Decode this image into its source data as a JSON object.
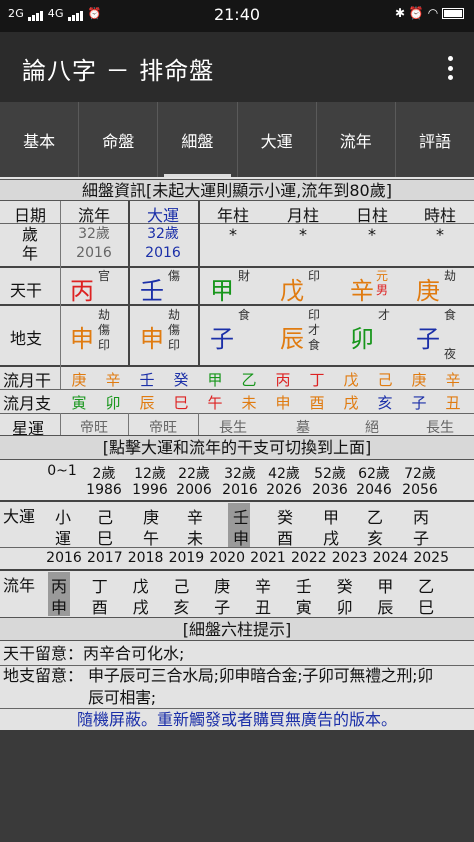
{
  "status": {
    "network1": "2G",
    "network2": "4G",
    "time": "21:40"
  },
  "app": {
    "title": "論八字 － 排命盤"
  },
  "tabs": [
    "基本",
    "命盤",
    "細盤",
    "大運",
    "流年",
    "評語"
  ],
  "section1_title": "細盤資訊[未起大運則顯示小運,流年到80歲]",
  "table": {
    "headers": [
      "日期",
      "流年",
      "大運",
      "年柱",
      "月柱",
      "日柱",
      "時柱"
    ],
    "age_label": "歲年",
    "age_cols": [
      {
        "age": "32歲",
        "year": "2016"
      },
      {
        "age": "32歲",
        "year": "2016"
      }
    ],
    "stars": [
      "*",
      "*",
      "*",
      "*"
    ],
    "tiangan_label": "天干",
    "tiangan": [
      {
        "char": "丙",
        "note": "官",
        "color": "red"
      },
      {
        "char": "壬",
        "note": "傷",
        "color": "blue"
      },
      {
        "char": "甲",
        "note": "財",
        "color": "green"
      },
      {
        "char": "戊",
        "note": "印",
        "color": "orange"
      },
      {
        "char": "辛",
        "note": "元男",
        "color": "orange"
      },
      {
        "char": "庚",
        "note": "劫",
        "color": "orange"
      }
    ],
    "dizhi_label": "地支",
    "dizhi": [
      {
        "char": "申",
        "notes": [
          "劫",
          "傷",
          "印"
        ],
        "color": "orange"
      },
      {
        "char": "申",
        "notes": [
          "劫",
          "傷",
          "印"
        ],
        "color": "orange"
      },
      {
        "char": "子",
        "notes": [
          "食"
        ],
        "color": "blue"
      },
      {
        "char": "辰",
        "notes": [
          "印",
          "才",
          "食"
        ],
        "color": "orange"
      },
      {
        "char": "卯",
        "notes": [
          "才"
        ],
        "color": "green"
      },
      {
        "char": "子",
        "notes": [
          "食",
          "夜"
        ],
        "color": "blue"
      }
    ],
    "liuyuegan_label": "流月干",
    "liuyuegan": [
      {
        "c": "庚",
        "col": "orange"
      },
      {
        "c": "辛",
        "col": "orange"
      },
      {
        "c": "壬",
        "col": "blue"
      },
      {
        "c": "癸",
        "col": "blue"
      },
      {
        "c": "甲",
        "col": "green"
      },
      {
        "c": "乙",
        "col": "green"
      },
      {
        "c": "丙",
        "col": "red"
      },
      {
        "c": "丁",
        "col": "red"
      },
      {
        "c": "戊",
        "col": "orange"
      },
      {
        "c": "己",
        "col": "orange"
      },
      {
        "c": "庚",
        "col": "orange"
      },
      {
        "c": "辛",
        "col": "orange"
      }
    ],
    "liuyuezhi_label": "流月支",
    "liuyuezhi": [
      {
        "c": "寅",
        "col": "green"
      },
      {
        "c": "卯",
        "col": "green"
      },
      {
        "c": "辰",
        "col": "orange"
      },
      {
        "c": "巳",
        "col": "red"
      },
      {
        "c": "午",
        "col": "red"
      },
      {
        "c": "未",
        "col": "orange"
      },
      {
        "c": "申",
        "col": "orange"
      },
      {
        "c": "酉",
        "col": "orange"
      },
      {
        "c": "戌",
        "col": "orange"
      },
      {
        "c": "亥",
        "col": "blue"
      },
      {
        "c": "子",
        "col": "blue"
      },
      {
        "c": "丑",
        "col": "orange"
      }
    ],
    "xingyun_label": "星運",
    "xingyun": [
      "帝旺",
      "帝旺",
      "長生",
      "墓",
      "絕",
      "長生"
    ]
  },
  "section2_title": "[點擊大運和流年的干支可切換到上面]",
  "dayun": {
    "ages": [
      "0~1",
      "2歲",
      "12歲",
      "22歲",
      "32歲",
      "42歲",
      "52歲",
      "62歲",
      "72歲"
    ],
    "years": [
      "",
      "1986",
      "1996",
      "2006",
      "2016",
      "2026",
      "2036",
      "2046",
      "2056"
    ],
    "label": "大運",
    "gan": [
      "小",
      "己",
      "庚",
      "辛",
      "壬",
      "癸",
      "甲",
      "乙",
      "丙"
    ],
    "zhi": [
      "運",
      "巳",
      "午",
      "未",
      "申",
      "酉",
      "戌",
      "亥",
      "子"
    ]
  },
  "liunian": {
    "years": [
      "2016",
      "2017",
      "2018",
      "2019",
      "2020",
      "2021",
      "2022",
      "2023",
      "2024",
      "2025"
    ],
    "label": "流年",
    "gan": [
      "丙",
      "丁",
      "戊",
      "己",
      "庚",
      "辛",
      "壬",
      "癸",
      "甲",
      "乙"
    ],
    "zhi": [
      "申",
      "酉",
      "戌",
      "亥",
      "子",
      "丑",
      "寅",
      "卯",
      "辰",
      "巳"
    ]
  },
  "section3_title": "[細盤六柱提示]",
  "tips": {
    "tiangan_label": "天干留意：",
    "tiangan_text": "丙辛合可化水;",
    "dizhi_label": "地支留意：",
    "dizhi_text1": "申子辰可三合水局;卯申暗合金;子卯可無禮之刑;卯",
    "dizhi_text2": "辰可相害;"
  },
  "banner": "隨機屏蔽。重新觸發或者購買無廣告的版本。"
}
